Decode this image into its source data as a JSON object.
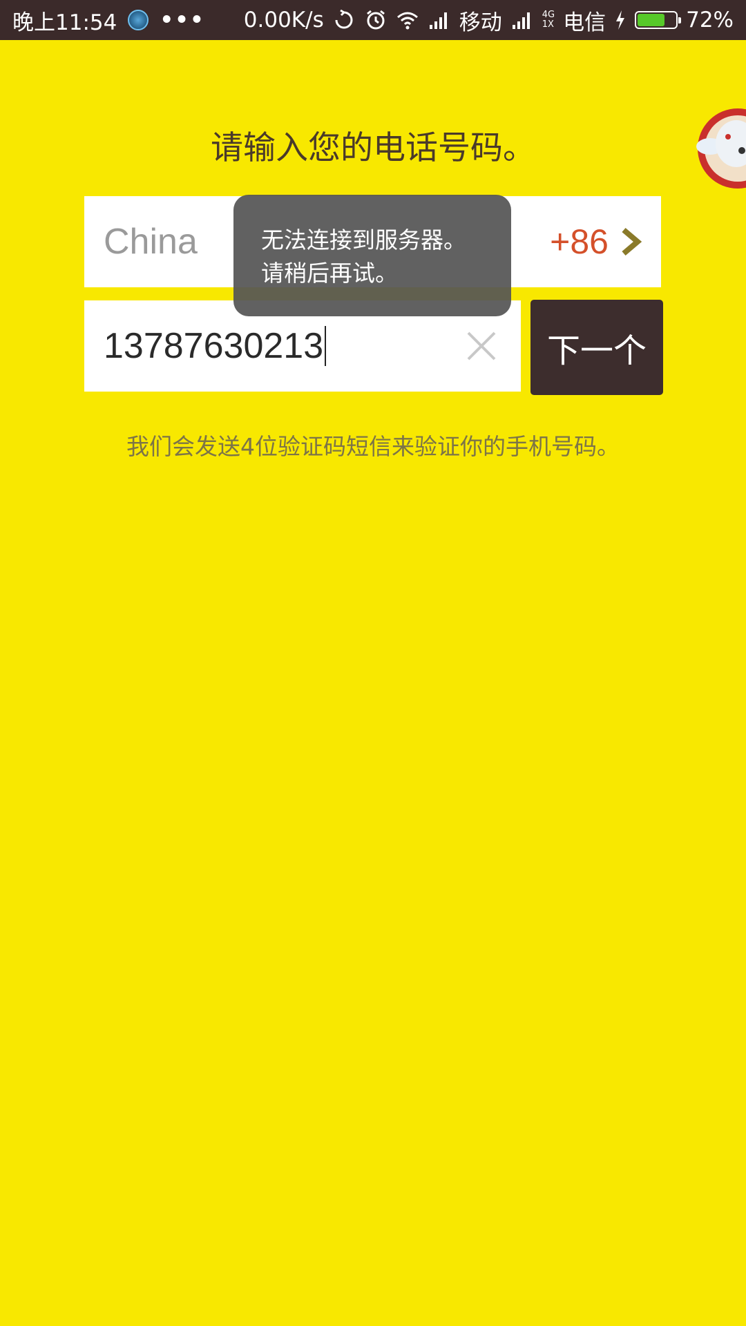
{
  "status_bar": {
    "time": "晚上11:54",
    "dots": "•••",
    "net_speed": "0.00K/s",
    "carrier1": "移动",
    "net_type_top": "4G",
    "net_type_bottom": "1X",
    "carrier2": "电信",
    "battery_percent": "72%",
    "battery_level": 0.72,
    "icons": [
      "app-loader-icon",
      "sync-icon",
      "alarm-icon",
      "wifi-icon",
      "signal-icon",
      "signal-icon",
      "charging-icon",
      "battery-icon"
    ]
  },
  "page": {
    "heading": "请输入您的电话号码。"
  },
  "country": {
    "name": "China",
    "code": "+86",
    "chevron_icon": "chevron-right-icon"
  },
  "phone": {
    "value": "13787630213",
    "clear_icon": "close-icon"
  },
  "next_button": {
    "label": "下一个"
  },
  "hint": "我们会发送4位验证码短信来验证你的手机号码。",
  "toast": {
    "line1": "无法连接到服务器。",
    "line2": "请稍后再试。"
  },
  "colors": {
    "background": "#F8E800",
    "status_bar": "#3B2A2A",
    "next_button": "#3D2D2D",
    "country_code": "#D4502A",
    "battery_fill": "#57C92A"
  }
}
